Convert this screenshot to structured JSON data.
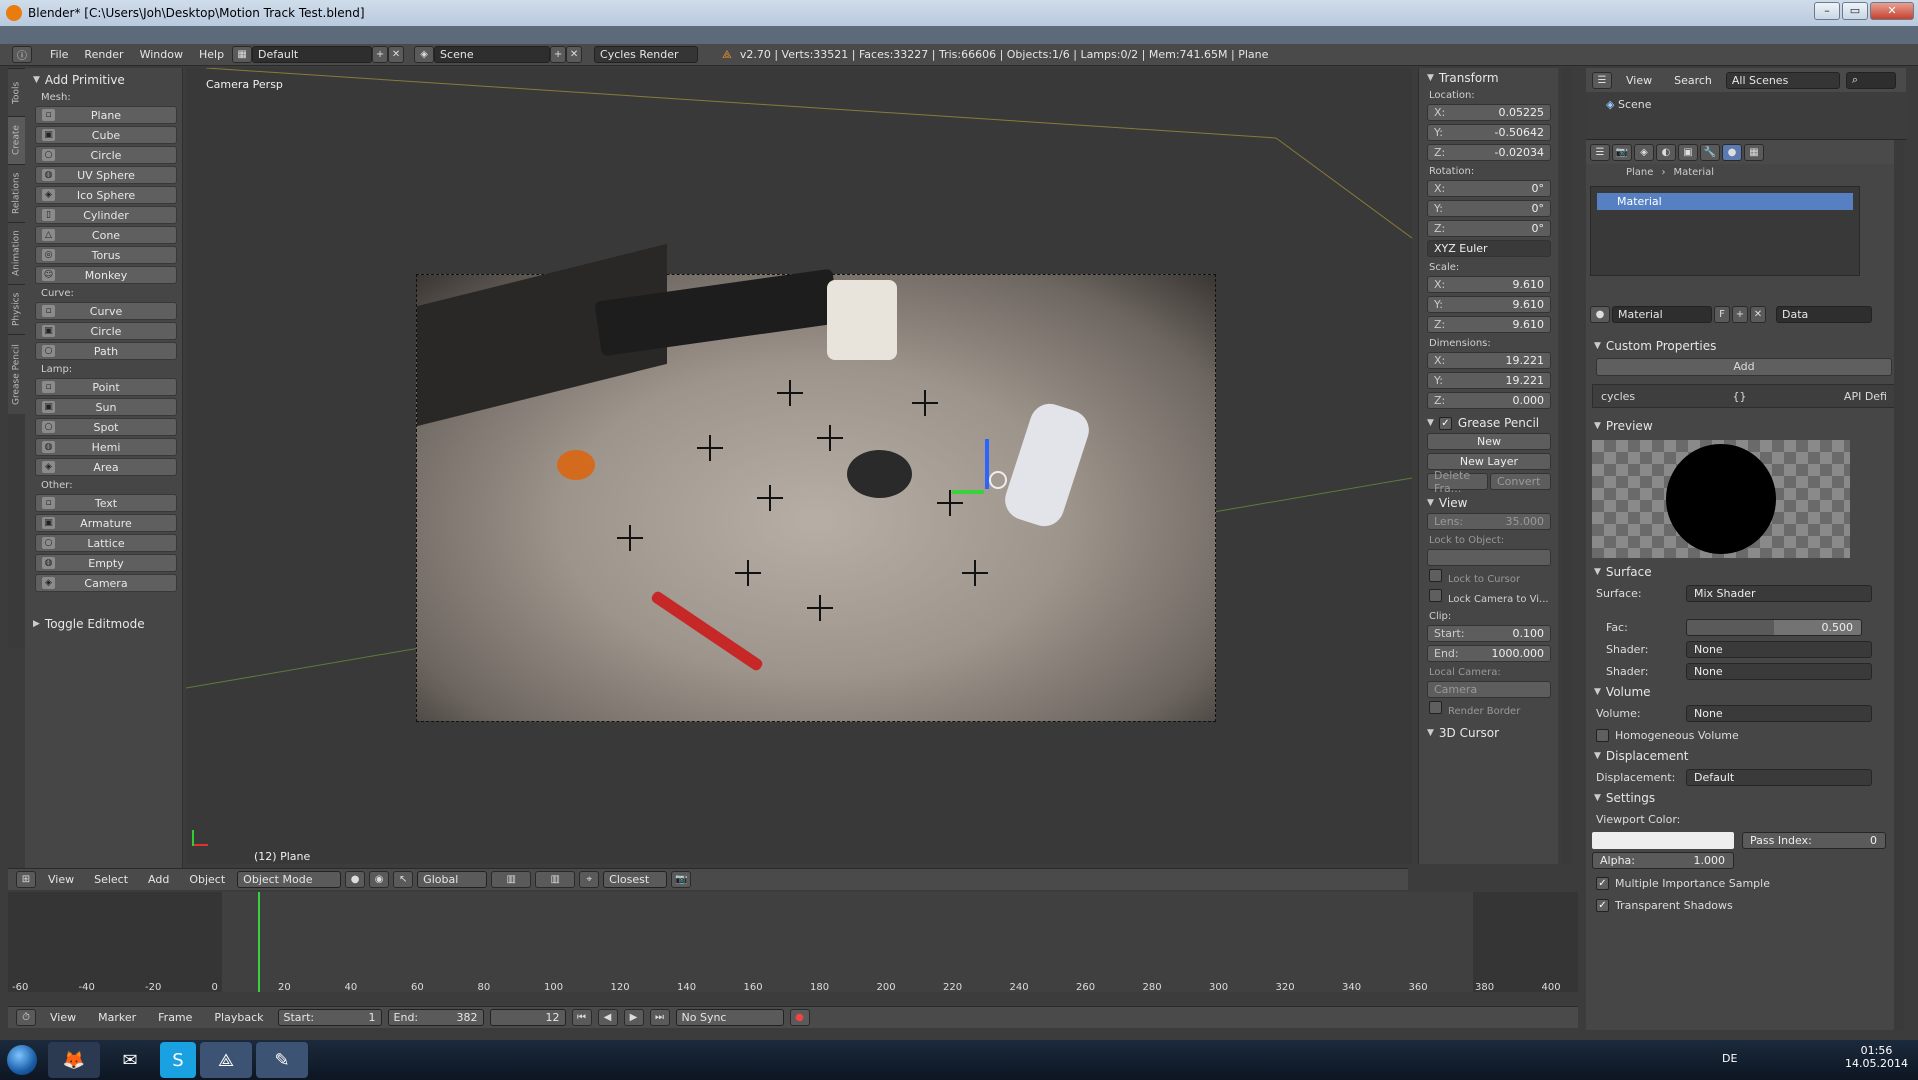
{
  "window": {
    "title": "Blender* [C:\\Users\\Joh\\Desktop\\Motion Track Test.blend]",
    "buttons": [
      "–",
      "▭",
      "✕"
    ]
  },
  "topbar": {
    "menus": [
      "File",
      "Render",
      "Window",
      "Help"
    ],
    "layout": "Default",
    "scene": "Scene",
    "engine": "Cycles Render",
    "stats": "v2.70 | Verts:33521 | Faces:33227 | Tris:66606 | Objects:1/6 | Lamps:0/2 | Mem:741.65M | Plane"
  },
  "toolshelf": {
    "tabs": [
      "Tools",
      "Create",
      "Relations",
      "Animation",
      "Physics",
      "Grease Pencil"
    ],
    "panel_title": "Add Primitive",
    "groups": [
      {
        "label": "Mesh:",
        "items": [
          "Plane",
          "Cube",
          "Circle",
          "UV Sphere",
          "Ico Sphere",
          "Cylinder",
          "Cone",
          "Torus",
          "Monkey"
        ]
      },
      {
        "label": "Curve:",
        "items": [
          "Curve",
          "Circle",
          "Path"
        ]
      },
      {
        "label": "Lamp:",
        "items": [
          "Point",
          "Sun",
          "Spot",
          "Hemi",
          "Area"
        ]
      },
      {
        "label": "Other:",
        "items": [
          "Text",
          "Armature",
          "Lattice",
          "Empty",
          "Camera"
        ]
      }
    ],
    "toggle": "Toggle Editmode"
  },
  "viewport": {
    "label": "Camera Persp",
    "object_label": "(12) Plane"
  },
  "vpheader": {
    "menus": [
      "View",
      "Select",
      "Add",
      "Object"
    ],
    "mode": "Object Mode",
    "orientation": "Global",
    "snap": "Closest"
  },
  "npanel": {
    "transform": "Transform",
    "location_label": "Location:",
    "location": [
      {
        "k": "X:",
        "v": "0.05225"
      },
      {
        "k": "Y:",
        "v": "-0.50642"
      },
      {
        "k": "Z:",
        "v": "-0.02034"
      }
    ],
    "rotation_label": "Rotation:",
    "rotation": [
      {
        "k": "X:",
        "v": "0°"
      },
      {
        "k": "Y:",
        "v": "0°"
      },
      {
        "k": "Z:",
        "v": "0°"
      }
    ],
    "euler": "XYZ Euler",
    "scale_label": "Scale:",
    "scale": [
      {
        "k": "X:",
        "v": "9.610"
      },
      {
        "k": "Y:",
        "v": "9.610"
      },
      {
        "k": "Z:",
        "v": "9.610"
      }
    ],
    "dimensions_label": "Dimensions:",
    "dimensions": [
      {
        "k": "X:",
        "v": "19.221"
      },
      {
        "k": "Y:",
        "v": "19.221"
      },
      {
        "k": "Z:",
        "v": "0.000"
      }
    ],
    "grease": "Grease Pencil",
    "new": "New",
    "new_layer": "New Layer",
    "delete_frame": "Delete Fra...",
    "convert": "Convert",
    "view": "View",
    "lens": "Lens:",
    "lens_v": "35.000",
    "lock_obj": "Lock to Object:",
    "lock_cursor": "Lock to Cursor",
    "lock_cam": "Lock Camera to Vi...",
    "clip": "Clip:",
    "clip_start_k": "Start:",
    "clip_start": "0.100",
    "clip_end_k": "End:",
    "clip_end": "1000.000",
    "local_cam": "Local Camera:",
    "camera": "Camera",
    "render_border": "Render Border",
    "cursor": "3D Cursor"
  },
  "outliner": {
    "menus": [
      "View",
      "Search"
    ],
    "scenes": "All Scenes",
    "scene": "Scene"
  },
  "props": {
    "breadcrumb": [
      "Plane",
      "Material"
    ],
    "slot": "Material",
    "mat_name": "Material",
    "mat_f": "F",
    "data": "Data",
    "custom": "Custom Properties",
    "add": "Add",
    "cycles": "cycles",
    "cycles_val": "{}",
    "api": "API Defi",
    "preview": "Preview",
    "surface_sec": "Surface",
    "surface_k": "Surface:",
    "surface_v": "Mix Shader",
    "fac_k": "Fac:",
    "fac_v": "0.500",
    "shader_k": "Shader:",
    "shader1": "None",
    "shader2": "None",
    "volume_sec": "Volume",
    "volume_k": "Volume:",
    "volume_v": "None",
    "homog": "Homogeneous Volume",
    "disp_sec": "Displacement",
    "disp_k": "Displacement:",
    "disp_v": "Default",
    "settings": "Settings",
    "vpcolor": "Viewport Color:",
    "pass": "Pass Index:",
    "pass_v": "0",
    "alpha_k": "Alpha:",
    "alpha_v": "1.000",
    "mis": "Multiple Importance Sample",
    "shadows": "Transparent Shadows"
  },
  "timeline": {
    "ticks": [
      "-60",
      "-40",
      "-20",
      "0",
      "20",
      "40",
      "60",
      "80",
      "100",
      "120",
      "140",
      "160",
      "180",
      "200",
      "220",
      "240",
      "260",
      "280",
      "300",
      "320",
      "340",
      "360",
      "380",
      "400"
    ],
    "menus": [
      "View",
      "Marker",
      "Frame",
      "Playback"
    ],
    "start_k": "Start:",
    "start": "1",
    "end_k": "End:",
    "end": "382",
    "frame": "12",
    "sync": "No Sync"
  },
  "taskbar": {
    "lang": "DE",
    "time": "01:56",
    "date": "14.05.2014"
  }
}
